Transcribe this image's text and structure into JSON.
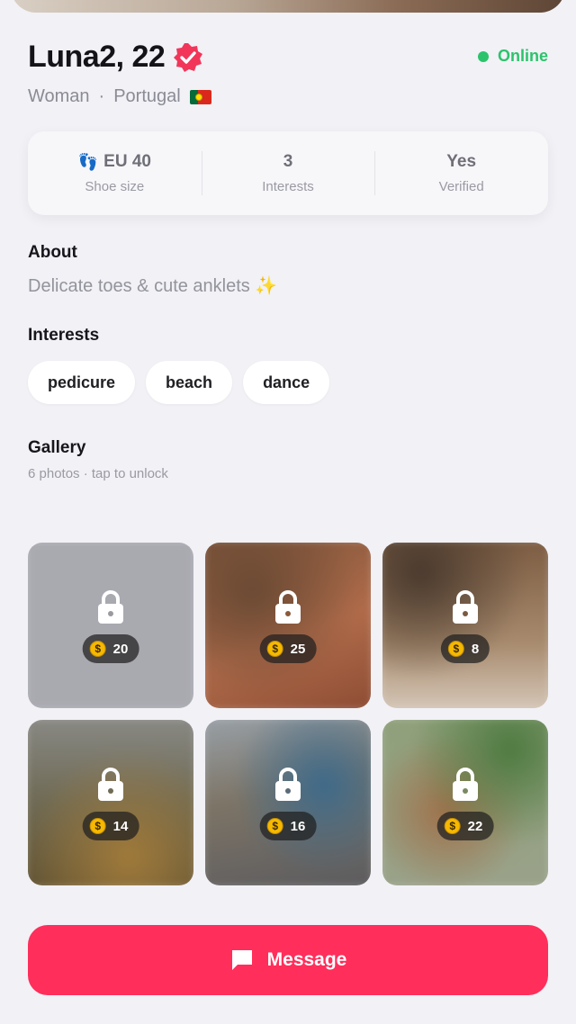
{
  "profile": {
    "name": "Luna2, 22",
    "status": "Online",
    "gender": "Woman",
    "separator": "·",
    "country": "Portugal"
  },
  "stats": [
    {
      "value": "EU 40",
      "label": "Shoe size",
      "icon": "feet-icon"
    },
    {
      "value": "3",
      "label": "Interests"
    },
    {
      "value": "Yes",
      "label": "Verified"
    }
  ],
  "about": {
    "title": "About",
    "text": "Delicate toes & cute anklets ✨"
  },
  "interests": {
    "title": "Interests",
    "items": [
      "pedicure",
      "beach",
      "dance"
    ]
  },
  "gallery": {
    "title": "Gallery",
    "subtitle": "6 photos · tap to unlock",
    "photos": [
      {
        "price": "20"
      },
      {
        "price": "25"
      },
      {
        "price": "8"
      },
      {
        "price": "14"
      },
      {
        "price": "16"
      },
      {
        "price": "22"
      }
    ]
  },
  "actions": {
    "message_label": "Message"
  },
  "colors": {
    "accent": "#ff2e5b",
    "online": "#2cc36b",
    "verified_badge": "#f2365a",
    "coin": "#f6b800"
  }
}
